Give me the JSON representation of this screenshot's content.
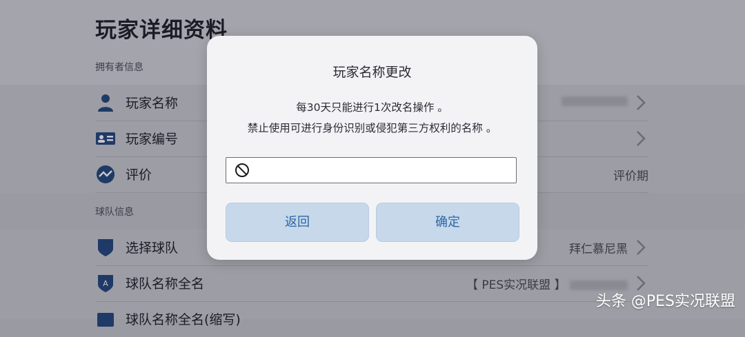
{
  "page": {
    "title": "玩家详细资料",
    "owner_section": "拥有者信息",
    "team_section": "球队信息"
  },
  "owner_rows": [
    {
      "label": "玩家名称",
      "icon": "person-icon",
      "value": ""
    },
    {
      "label": "玩家编号",
      "icon": "id-card-icon",
      "value": ""
    },
    {
      "label": "评价",
      "icon": "rating-icon",
      "value": "评价期"
    }
  ],
  "team_rows": [
    {
      "label": "选择球队",
      "icon": "shield-icon",
      "value": "拜仁慕尼黑"
    },
    {
      "label": "球队名称全名",
      "icon": "team-badge-icon",
      "value": "【 PES实况联盟 】"
    },
    {
      "label": "球队名称全名(缩写)",
      "icon": "team-abbr-icon",
      "value": ""
    }
  ],
  "dialog": {
    "title": "玩家名称更改",
    "line1": "每30天只能进行1次改名操作 。",
    "line2": "禁止使用可进行身份识别或侵犯第三方权利的名称 。",
    "input_value": "",
    "back_label": "返回",
    "confirm_label": "确定"
  },
  "watermark": "头条 @PES实况联盟",
  "colors": {
    "accent": "#2a67a8",
    "button_bg": "#c7d8ea",
    "icon": "#1f3a66"
  }
}
